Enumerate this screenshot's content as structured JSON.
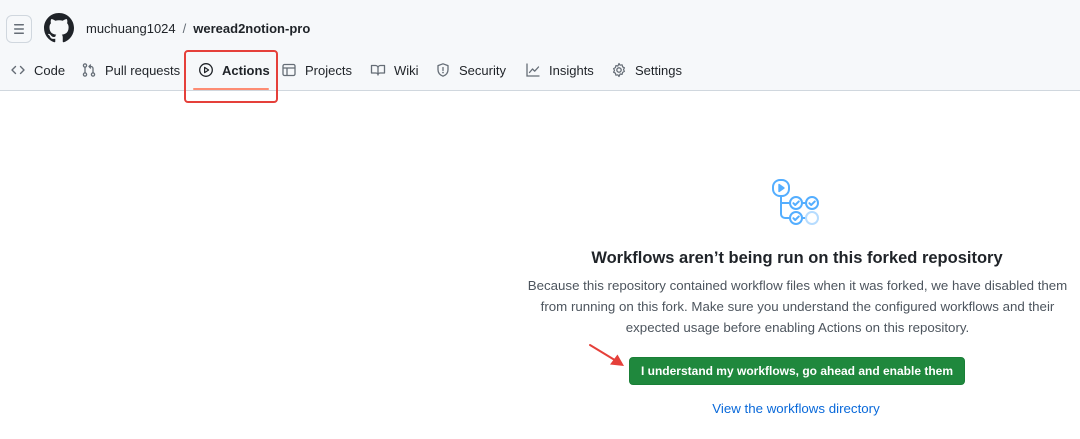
{
  "breadcrumb": {
    "owner": "muchuang1024",
    "separator": "/",
    "repo": "weread2notion-pro"
  },
  "tabs": [
    {
      "label": "Code",
      "icon": "code-icon"
    },
    {
      "label": "Pull requests",
      "icon": "git-pull-request-icon"
    },
    {
      "label": "Actions",
      "icon": "play-icon",
      "active": true
    },
    {
      "label": "Projects",
      "icon": "table-icon"
    },
    {
      "label": "Wiki",
      "icon": "book-icon"
    },
    {
      "label": "Security",
      "icon": "shield-icon"
    },
    {
      "label": "Insights",
      "icon": "graph-icon"
    },
    {
      "label": "Settings",
      "icon": "gear-icon"
    }
  ],
  "main": {
    "illustration_icon": "workflow-icon",
    "title": "Workflows aren’t being run on this forked repository",
    "description_lines": [
      "Because this repository contained workflow files when it was forked, we have disabled them",
      "from running on this fork. Make sure you understand the configured workflows and their",
      "expected usage before enabling Actions on this repository."
    ],
    "enable_button": "I understand my workflows, go ahead and enable them",
    "directory_link": "View the workflows directory"
  },
  "colors": {
    "header_bg": "#f6f8fa",
    "active_underline": "#fd8c73",
    "annotation_red": "#e5403a",
    "primary_button": "#1f883d",
    "link": "#0969da",
    "illustration_blue": "#54aeff"
  }
}
